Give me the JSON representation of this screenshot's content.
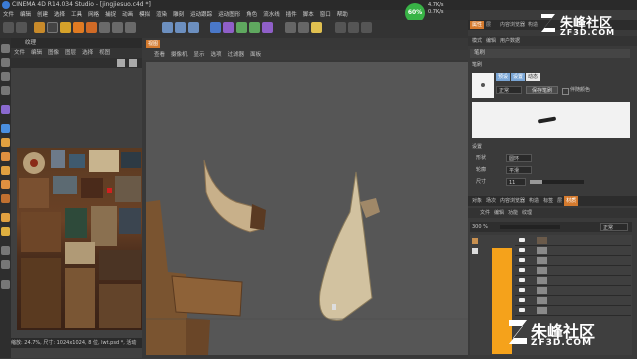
{
  "titlebar": {
    "title": "CINEMA 4D R14.034 Studio - [jingjiesuo.c4d *]"
  },
  "menu": [
    "文件",
    "编辑",
    "创建",
    "选择",
    "工具",
    "网格",
    "捕捉",
    "动画",
    "模拟",
    "渲染",
    "雕刻",
    "运动跟踪",
    "运动图形",
    "角色",
    "流水线",
    "插件",
    "脚本",
    "窗口",
    "帮助"
  ],
  "network": {
    "percent": "60%",
    "up": "4.7K/s",
    "down": "0.7K/s"
  },
  "texture_panel": {
    "header": "纹理",
    "menu": [
      "文件",
      "编辑",
      "图像",
      "图层",
      "选择",
      "视图"
    ],
    "status": "缩放: 24.7%, 尺寸: 1024x1024, 8 位, lwt.psd *, 活动"
  },
  "viewport": {
    "tab": "视图",
    "menu": [
      "查看",
      "摄像机",
      "显示",
      "选项",
      "过滤器",
      "面板"
    ]
  },
  "right_panel": {
    "tabs": [
      "属性",
      "层",
      "内容浏览器",
      "构造"
    ],
    "menu": [
      "模式",
      "编辑",
      "用户数据"
    ],
    "section": "笔刷",
    "brush_label": "笔刷",
    "buttons": [
      "预设",
      "设置",
      "动态"
    ],
    "dropdown_mode": "正常",
    "save_button": "保存笔刷",
    "checkbox_label": "伴随颜色",
    "settings_label": "设置",
    "props": [
      {
        "label": "形状",
        "value": "圆环"
      },
      {
        "label": "轮廓",
        "value": "平滑"
      },
      {
        "label": "尺寸",
        "value": "11"
      }
    ],
    "lower_tabs": [
      "对象",
      "场次",
      "内容浏览器",
      "构造",
      "标签",
      "层",
      "材质",
      "对象"
    ],
    "lower_menu": [
      "文件",
      "编辑",
      "功能",
      "纹理"
    ],
    "layer_zoom": "300 %",
    "layer_mode": "正常",
    "layer_count": 8
  },
  "watermarks": {
    "top": "朱峰社区",
    "top_url": "ZF3D.COM",
    "bottom": "朱峰社区",
    "bottom_url": "ZF3D.COM"
  },
  "colors": {
    "accent": "#d47a2e",
    "layer_orange": "#f5a21b",
    "viewport_bg": "#565656"
  }
}
